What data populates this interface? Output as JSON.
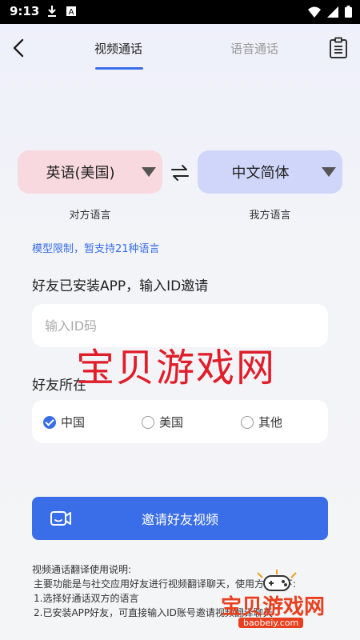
{
  "status": {
    "time": "9:13"
  },
  "header": {
    "tab_video": "视频通话",
    "tab_voice": "语音通话"
  },
  "languages": {
    "left": "英语(美国)",
    "right": "中文简体",
    "left_caption": "对方语言",
    "right_caption": "我方语言"
  },
  "limit_note": "模型限制，暂支持21种语言",
  "invite": {
    "label": "好友已安装APP，输入ID邀请",
    "placeholder": "输入ID码",
    "value": ""
  },
  "location": {
    "label": "好友所在",
    "options": [
      "中国",
      "美国",
      "其他"
    ],
    "selected": "中国"
  },
  "invite_button": "邀请好友视频",
  "help": {
    "title": "视频通话翻译使用说明:",
    "lines": [
      "主要功能是与社交应用好友进行视频翻译聊天，使用方法如下:",
      "1.选择好通话双方的语言",
      "2.已安装APP好友，可直接输入ID账号邀请视频翻译聊天"
    ]
  },
  "watermark": {
    "big": "宝贝游戏网",
    "small": "宝贝游戏网",
    "url": "baobeiy.com"
  },
  "colors": {
    "accent": "#3a6ee8",
    "left_pill": "#f8d9df",
    "right_pill": "#cfd6f9",
    "watermark": "#e01e2a"
  }
}
